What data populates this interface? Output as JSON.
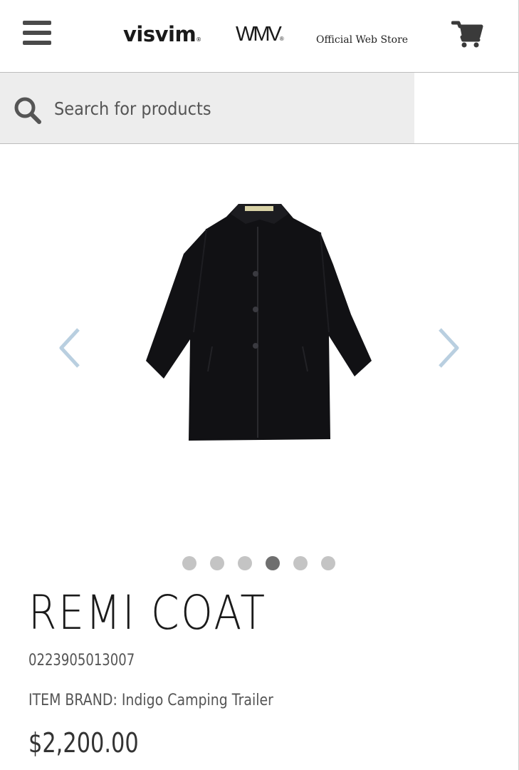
{
  "header": {
    "menu_icon": "hamburger-menu-icon",
    "logo_visvim": "visvim",
    "logo_wmv": "WMV",
    "registered_mark": "®",
    "store_label": "Official Web Store",
    "cart_icon": "shopping-cart-icon"
  },
  "search": {
    "icon": "search-icon",
    "placeholder": "Search for products"
  },
  "gallery": {
    "prev_icon": "chevron-left-icon",
    "next_icon": "chevron-right-icon",
    "image_subject": "black coat",
    "slide_count": 6,
    "active_slide": 4
  },
  "product": {
    "title": "REMI COAT",
    "sku": "0223905013007",
    "brand_line": "ITEM BRAND: Indigo Camping Trailer",
    "price": "$2,200.00"
  },
  "colors": {
    "header_text": "#1a1a1a",
    "icon_gray": "#4a4a4a",
    "search_bg": "#ededed",
    "arrow_blue": "#b9cfe0",
    "dot_inactive": "#c4c4c4",
    "dot_active": "#6f6f6f"
  }
}
